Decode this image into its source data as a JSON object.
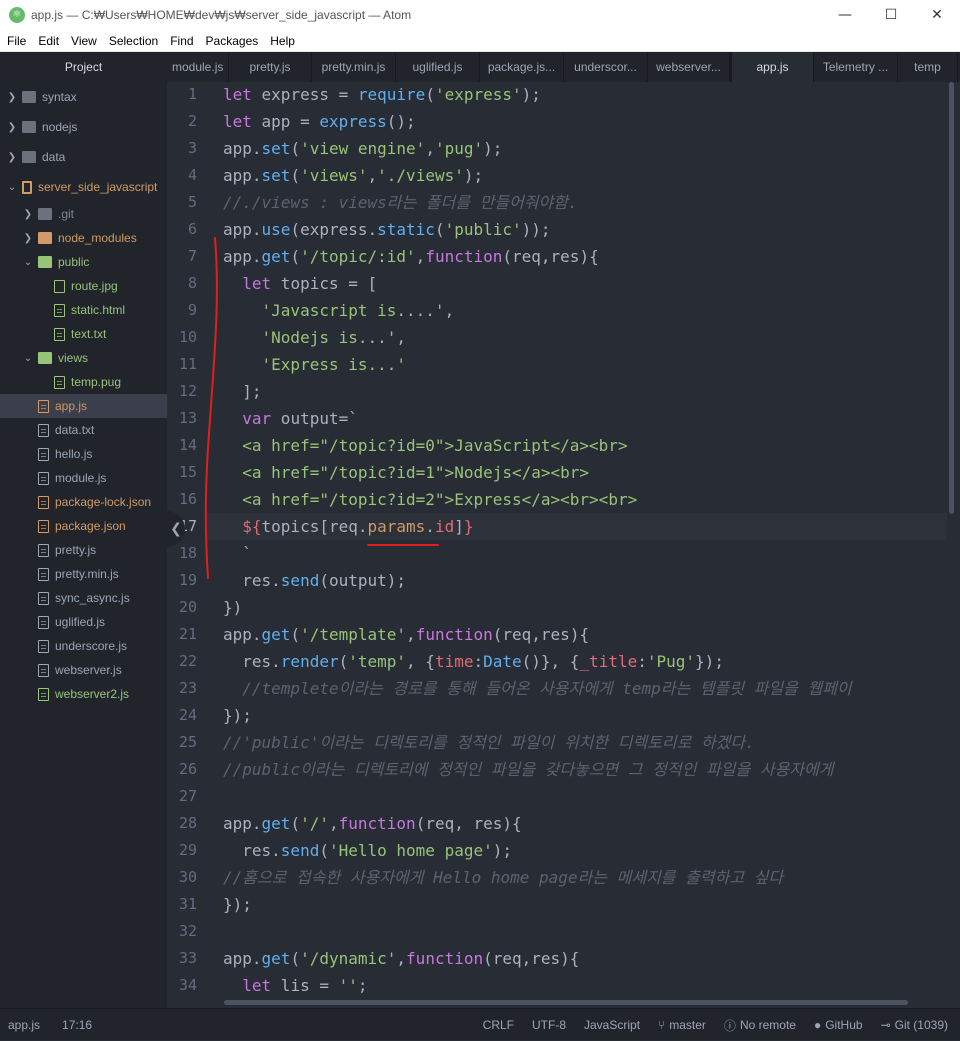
{
  "window": {
    "title": "app.js — C:₩Users₩HOME₩dev₩js₩server_side_javascript — Atom",
    "minimize": "—",
    "maximize": "☐",
    "close": "✕"
  },
  "menu": [
    "File",
    "Edit",
    "View",
    "Selection",
    "Find",
    "Packages",
    "Help"
  ],
  "tree": {
    "header": "Project",
    "items": [
      {
        "label": "syntax",
        "type": "folder",
        "state": "collapsed"
      },
      {
        "label": "nodejs",
        "type": "folder",
        "state": "collapsed"
      },
      {
        "label": "data",
        "type": "folder",
        "state": "collapsed"
      },
      {
        "label": "server_side_javascript",
        "type": "repo",
        "state": "expanded"
      },
      {
        "label": ".git",
        "type": "folder",
        "state": "collapsed"
      },
      {
        "label": "node_modules",
        "type": "folder",
        "state": "collapsed"
      },
      {
        "label": "public",
        "type": "folder",
        "state": "expanded"
      },
      {
        "label": "route.jpg",
        "type": "image"
      },
      {
        "label": "static.html",
        "type": "file"
      },
      {
        "label": "text.txt",
        "type": "file"
      },
      {
        "label": "views",
        "type": "folder",
        "state": "expanded"
      },
      {
        "label": "temp.pug",
        "type": "file"
      },
      {
        "label": "app.js",
        "type": "file",
        "selected": true
      },
      {
        "label": "data.txt",
        "type": "file"
      },
      {
        "label": "hello.js",
        "type": "file"
      },
      {
        "label": "module.js",
        "type": "file"
      },
      {
        "label": "package-lock.json",
        "type": "file"
      },
      {
        "label": "package.json",
        "type": "file"
      },
      {
        "label": "pretty.js",
        "type": "file"
      },
      {
        "label": "pretty.min.js",
        "type": "file"
      },
      {
        "label": "sync_async.js",
        "type": "file"
      },
      {
        "label": "uglified.js",
        "type": "file"
      },
      {
        "label": "underscore.js",
        "type": "file"
      },
      {
        "label": "webserver.js",
        "type": "file"
      },
      {
        "label": "webserver2.js",
        "type": "file"
      }
    ]
  },
  "tabs": [
    {
      "label": "module.js"
    },
    {
      "label": "pretty.js"
    },
    {
      "label": "pretty.min.js"
    },
    {
      "label": "uglified.js"
    },
    {
      "label": "package.js..."
    },
    {
      "label": "underscor..."
    },
    {
      "label": "webserver..."
    },
    {
      "label": "app.js",
      "active": true
    },
    {
      "label": "Telemetry ..."
    },
    {
      "label": "temp"
    }
  ],
  "editor": {
    "line_numbers": [
      "1",
      "2",
      "3",
      "4",
      "5",
      "6",
      "7",
      "8",
      "9",
      "10",
      "11",
      "12",
      "13",
      "14",
      "15",
      "16",
      "17",
      "18",
      "19",
      "20",
      "21",
      "22",
      "23",
      "24",
      "25",
      "26",
      "27",
      "28",
      "29",
      "30",
      "31",
      "32",
      "33",
      "34"
    ],
    "lines": [
      [
        [
          "k",
          "let"
        ],
        [
          "t",
          " express = "
        ],
        [
          "f",
          "require"
        ],
        [
          "t",
          "("
        ],
        [
          "s",
          "'express'"
        ],
        [
          "t",
          ");"
        ]
      ],
      [
        [
          "k",
          "let"
        ],
        [
          "t",
          " app = "
        ],
        [
          "f",
          "express"
        ],
        [
          "t",
          "();"
        ]
      ],
      [
        [
          "t",
          "app."
        ],
        [
          "f",
          "set"
        ],
        [
          "t",
          "("
        ],
        [
          "s",
          "'view engine'"
        ],
        [
          "t",
          ","
        ],
        [
          "s",
          "'pug'"
        ],
        [
          "t",
          ");"
        ]
      ],
      [
        [
          "t",
          "app."
        ],
        [
          "f",
          "set"
        ],
        [
          "t",
          "("
        ],
        [
          "s",
          "'views'"
        ],
        [
          "t",
          ","
        ],
        [
          "s",
          "'./views'"
        ],
        [
          "t",
          ");"
        ]
      ],
      [
        [
          "c",
          "//./views : views라는 폴더를 만들어줘야함."
        ]
      ],
      [
        [
          "t",
          "app."
        ],
        [
          "f",
          "use"
        ],
        [
          "t",
          "(express."
        ],
        [
          "f",
          "static"
        ],
        [
          "t",
          "("
        ],
        [
          "s",
          "'public'"
        ],
        [
          "t",
          "));"
        ]
      ],
      [
        [
          "t",
          "app."
        ],
        [
          "f",
          "get"
        ],
        [
          "t",
          "("
        ],
        [
          "s",
          "'/topic/:id'"
        ],
        [
          "t",
          ","
        ],
        [
          "k",
          "function"
        ],
        [
          "t",
          "(req,res){"
        ]
      ],
      [
        [
          "t",
          "  "
        ],
        [
          "k",
          "let"
        ],
        [
          "t",
          " topics = ["
        ]
      ],
      [
        [
          "t",
          "    "
        ],
        [
          "s",
          "'Javascript is....'"
        ],
        [
          "t",
          ","
        ]
      ],
      [
        [
          "t",
          "    "
        ],
        [
          "s",
          "'Nodejs is...'"
        ],
        [
          "t",
          ","
        ]
      ],
      [
        [
          "t",
          "    "
        ],
        [
          "s",
          "'Express is...'"
        ]
      ],
      [
        [
          "t",
          "  ];"
        ]
      ],
      [
        [
          "t",
          "  "
        ],
        [
          "k",
          "var"
        ],
        [
          "t",
          " output="
        ],
        [
          "s",
          "`"
        ]
      ],
      [
        [
          "s",
          "  <a href=\"/topic?id=0\">JavaScript</a><br>"
        ]
      ],
      [
        [
          "s",
          "  <a href=\"/topic?id=1\">Nodejs</a><br>"
        ]
      ],
      [
        [
          "s",
          "  <a href=\"/topic?id=2\">Express</a><br><br>"
        ]
      ],
      [
        [
          "t",
          "  "
        ],
        [
          "r",
          "${"
        ],
        [
          "t",
          "topics[req."
        ],
        [
          "o",
          "params"
        ],
        [
          "t",
          "."
        ],
        [
          "r",
          "id"
        ],
        [
          "t",
          "]"
        ],
        [
          "r",
          "}"
        ]
      ],
      [
        [
          "s",
          "  `"
        ]
      ],
      [
        [
          "t",
          "  res."
        ],
        [
          "f",
          "send"
        ],
        [
          "t",
          "(output);"
        ]
      ],
      [
        [
          "t",
          "})"
        ]
      ],
      [
        [
          "t",
          "app."
        ],
        [
          "f",
          "get"
        ],
        [
          "t",
          "("
        ],
        [
          "s",
          "'/template'"
        ],
        [
          "t",
          ","
        ],
        [
          "k",
          "function"
        ],
        [
          "t",
          "(req,res){"
        ]
      ],
      [
        [
          "t",
          "  res."
        ],
        [
          "f",
          "render"
        ],
        [
          "t",
          "("
        ],
        [
          "s",
          "'temp'"
        ],
        [
          "t",
          ", {"
        ],
        [
          "r",
          "time"
        ],
        [
          "t",
          ":"
        ],
        [
          "f",
          "Date"
        ],
        [
          "t",
          "()}, {"
        ],
        [
          "r",
          "_title"
        ],
        [
          "t",
          ":"
        ],
        [
          "s",
          "'Pug'"
        ],
        [
          "t",
          "});"
        ]
      ],
      [
        [
          "t",
          "  "
        ],
        [
          "c",
          "//templete이라는 경로를 통해 들어온 사용자에게 temp라는 템플릿 파일을 웹페이"
        ]
      ],
      [
        [
          "t",
          "});"
        ]
      ],
      [
        [
          "c",
          "//'public'이라는 디렉토리를 정적인 파일이 위치한 디렉토리로 하겠다."
        ]
      ],
      [
        [
          "c",
          "//public이라는 디렉토리에 정적인 파일을 갖다놓으면 그 정적인 파일을 사용자에게"
        ]
      ],
      [],
      [
        [
          "t",
          "app."
        ],
        [
          "f",
          "get"
        ],
        [
          "t",
          "("
        ],
        [
          "s",
          "'/'"
        ],
        [
          "t",
          ","
        ],
        [
          "k",
          "function"
        ],
        [
          "t",
          "(req, res){"
        ]
      ],
      [
        [
          "t",
          "  res."
        ],
        [
          "f",
          "send"
        ],
        [
          "t",
          "("
        ],
        [
          "s",
          "'Hello home page'"
        ],
        [
          "t",
          ");"
        ]
      ],
      [
        [
          "c",
          "//홈으로 접속한 사용자에게 Hello home page라는 메세지를 출력하고 싶다"
        ]
      ],
      [
        [
          "t",
          "});"
        ]
      ],
      [],
      [
        [
          "t",
          "app."
        ],
        [
          "f",
          "get"
        ],
        [
          "t",
          "("
        ],
        [
          "s",
          "'/dynamic'"
        ],
        [
          "t",
          ","
        ],
        [
          "k",
          "function"
        ],
        [
          "t",
          "(req,res){"
        ]
      ],
      [
        [
          "t",
          "  "
        ],
        [
          "k",
          "let"
        ],
        [
          "t",
          " lis = "
        ],
        [
          "s",
          "''"
        ],
        [
          "t",
          ";"
        ]
      ]
    ],
    "cursor_line": 17
  },
  "status": {
    "file": "app.js",
    "position": "17:16",
    "line_ending": "CRLF",
    "encoding": "UTF-8",
    "grammar": "JavaScript",
    "branch": "master",
    "remote": "No remote",
    "github": "GitHub",
    "git": "Git (1039)"
  },
  "colors": {
    "annotation": "#e0201e",
    "editor_bg": "#282c34",
    "sidebar_bg": "#21252b"
  }
}
